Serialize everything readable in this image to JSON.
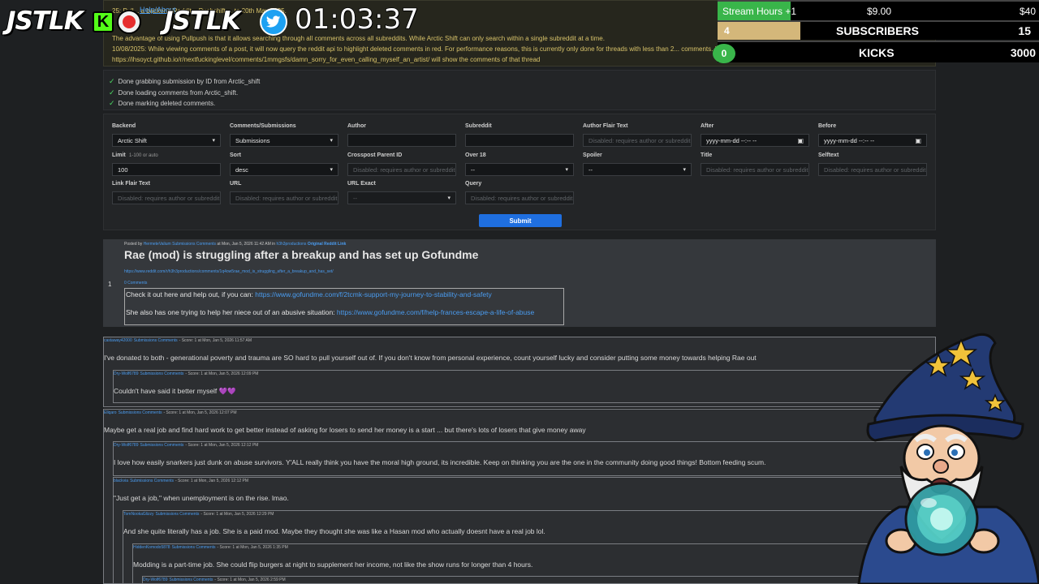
{
  "notice": {
    "help_link": "Help/About",
    "line1": "25: Pull...                        a backend Reddit... Pushshift ... to 20th May 2025.",
    "line2": "The advantage of using Pullpush is that it allows searching through all comments across all subreddits. While Arctic Shift can only search within a single subreddit at a time.",
    "line3": "10/08/2025: While viewing comments of a post, it will now query the reddit api to highlight deleted comments in red. For performance reasons, this is currently only done for threads with less than 2... comments. In addition it now supports redd... E.g.",
    "line4": "https://ihsoyct.github.io/r/nextfuckinglevel/comments/1mmgsfs/damn_sorry_for_even_calling_myself_an_artist/ will show the comments of that thread"
  },
  "status": [
    "Done grabbing submission by ID from Arctic_shift",
    "Done loading comments from Arctic_shift.",
    "Done marking deleted comments."
  ],
  "form": {
    "fields": [
      {
        "label": "Backend",
        "sub": "",
        "value": "Arctic Shift",
        "kind": "select",
        "disabled": false
      },
      {
        "label": "Comments/Submissions",
        "sub": "",
        "value": "Submissions",
        "kind": "select",
        "disabled": false
      },
      {
        "label": "Author",
        "sub": "",
        "value": "",
        "kind": "input",
        "disabled": false
      },
      {
        "label": "Subreddit",
        "sub": "",
        "value": "",
        "kind": "input",
        "disabled": false
      },
      {
        "label": "Author Flair Text",
        "sub": "",
        "value": "Disabled: requires author or subreddit",
        "kind": "input",
        "disabled": true
      },
      {
        "label": "After",
        "sub": "",
        "value": "yyyy-mm-dd --:-- --",
        "kind": "date",
        "disabled": false
      },
      {
        "label": "Before",
        "sub": "",
        "value": "yyyy-mm-dd --:-- --",
        "kind": "date",
        "disabled": false
      },
      {
        "label": "Limit",
        "sub": "1-100 or auto",
        "value": "100",
        "kind": "input",
        "disabled": false
      },
      {
        "label": "Sort",
        "sub": "",
        "value": "desc",
        "kind": "select",
        "disabled": false
      },
      {
        "label": "Crosspost Parent ID",
        "sub": "",
        "value": "Disabled: requires author or subreddit",
        "kind": "input",
        "disabled": true
      },
      {
        "label": "Over 18",
        "sub": "",
        "value": "--",
        "kind": "select",
        "disabled": false
      },
      {
        "label": "Spoiler",
        "sub": "",
        "value": "--",
        "kind": "select",
        "disabled": false
      },
      {
        "label": "Title",
        "sub": "",
        "value": "Disabled: requires author or subreddit",
        "kind": "input",
        "disabled": true
      },
      {
        "label": "Selftext",
        "sub": "",
        "value": "Disabled: requires author or subreddit",
        "kind": "input",
        "disabled": true
      },
      {
        "label": "Link Flair Text",
        "sub": "",
        "value": "Disabled: requires author or subreddit",
        "kind": "input",
        "disabled": true
      },
      {
        "label": "URL",
        "sub": "",
        "value": "Disabled: requires author or subreddit",
        "kind": "input",
        "disabled": true
      },
      {
        "label": "URL Exact",
        "sub": "",
        "value": "--",
        "kind": "select",
        "disabled": true
      },
      {
        "label": "Query",
        "sub": "",
        "value": "Disabled: requires author or subreddit",
        "kind": "input",
        "disabled": true
      }
    ],
    "submit_label": "Submit"
  },
  "post": {
    "meta_prefix": "Posted by",
    "author": "HermeteValium",
    "author_links": "Submissions Comments",
    "meta_mid": "at Mon, Jan 5, 2026 11:42 AM in",
    "subreddit": "h3h3productions",
    "reddit_link": "Original Reddit Link",
    "title": "Rae (mod) is struggling after a breakup and has set up Gofundme",
    "url": "https://www.reddit.com/r/h3h3productions/comments/1q4ow5rae_mod_is_struggling_after_a_breakup_and_has_set/",
    "score": "1",
    "comments_count": "0 Comments",
    "body_line1_text": "Check it out here and help out, if you can:",
    "body_line1_link": "https://www.gofundme.com/f/2tcmk-support-my-journey-to-stability-and-safety",
    "body_line2_text": "She also has one trying to help her niece out of an abusive situation:",
    "body_line2_link": "https://www.gofundme.com/f/help-frances-escape-a-life-of-abuse"
  },
  "comments": [
    {
      "author": "castaway42000",
      "links": "Submissions Comments",
      "meta": "- Score: 1 at Mon, Jan 5, 2026 11:57 AM",
      "text": "I've donated to both - generational poverty and trauma are SO hard to pull yourself out of. If you don't know from personal experience, count yourself lucky and consider putting some money towards helping Rae out"
    },
    {
      "author": "Dry-Wolf6789",
      "links": "Submissions Comments",
      "meta": "- Score: 1 at Mon, Jan 5, 2026 12:09 PM",
      "text": "Couldn't have said it better myself 💜💜"
    },
    {
      "author": "Ellqaro",
      "links": "Submissions Comments",
      "meta": "- Score: 1 at Mon, Jan 5, 2026 12:07 PM",
      "text": "Maybe get a real job and find hard work to get better instead of asking for losers to send her money is a start ... but there's lots of losers that give money away"
    },
    {
      "author": "Dry-Wolf6789",
      "links": "Submissions Comments",
      "meta": "- Score: 1 at Mon, Jan 5, 2026 12:12 PM",
      "text": "I love how easily snarkers just dunk on abuse survivors. Y'ALL really think you have the moral high ground, its incredible. Keep on thinking you are the one in the community doing good things! Bottom feeding scum."
    },
    {
      "author": "blackvia",
      "links": "Submissions Comments",
      "meta": "- Score: 1 at Mon, Jan 5, 2026 12:12 PM",
      "text": "\"Just get a job,\" when unemployment is on the rise. lmao."
    },
    {
      "author": "TomNookaGlizzy",
      "links": "Submissions Comments",
      "meta": "- Score: 1 at Mon, Jan 5, 2026 12:29 PM",
      "text": "And she quite literally has a job. She is a paid mod. Maybe they thought she was like a Hasan mod who actually doesnt have a real job lol."
    },
    {
      "author": "HiddenKomodo5878",
      "links": "Submissions Comments",
      "meta": "- Score: 1 at Mon, Jan 5, 2026 1:35 PM",
      "text": "Modding is a part-time job. She could flip burgers at night to supplement her income, not like the show runs for longer than 4 hours."
    },
    {
      "author": "Dry-Wolf6789",
      "links": "Submissions Comments",
      "meta": "- Score: 1 at Mon, Jan 5, 2026 2:59 PM",
      "text": ""
    }
  ],
  "overlay": {
    "logo_text": "JSTLK",
    "logo_text_2": "JSTLK",
    "kick_badge": "K",
    "timer": "01:03:37",
    "stream_hours_label": "Stream Hours +1",
    "stream_hours_amount": "$9.00",
    "stream_hours_goal": "$40",
    "subscribers_count": "4",
    "subscribers_label": "SUBSCRIBERS",
    "subscribers_goal": "15",
    "kicks_count": "0",
    "kicks_label": "KICKS",
    "kicks_goal": "3000"
  },
  "colors": {
    "link": "#4a9cf0",
    "submit": "#1f6fe0",
    "kick_green": "#53fc18",
    "notice_text": "#d8c36a"
  }
}
